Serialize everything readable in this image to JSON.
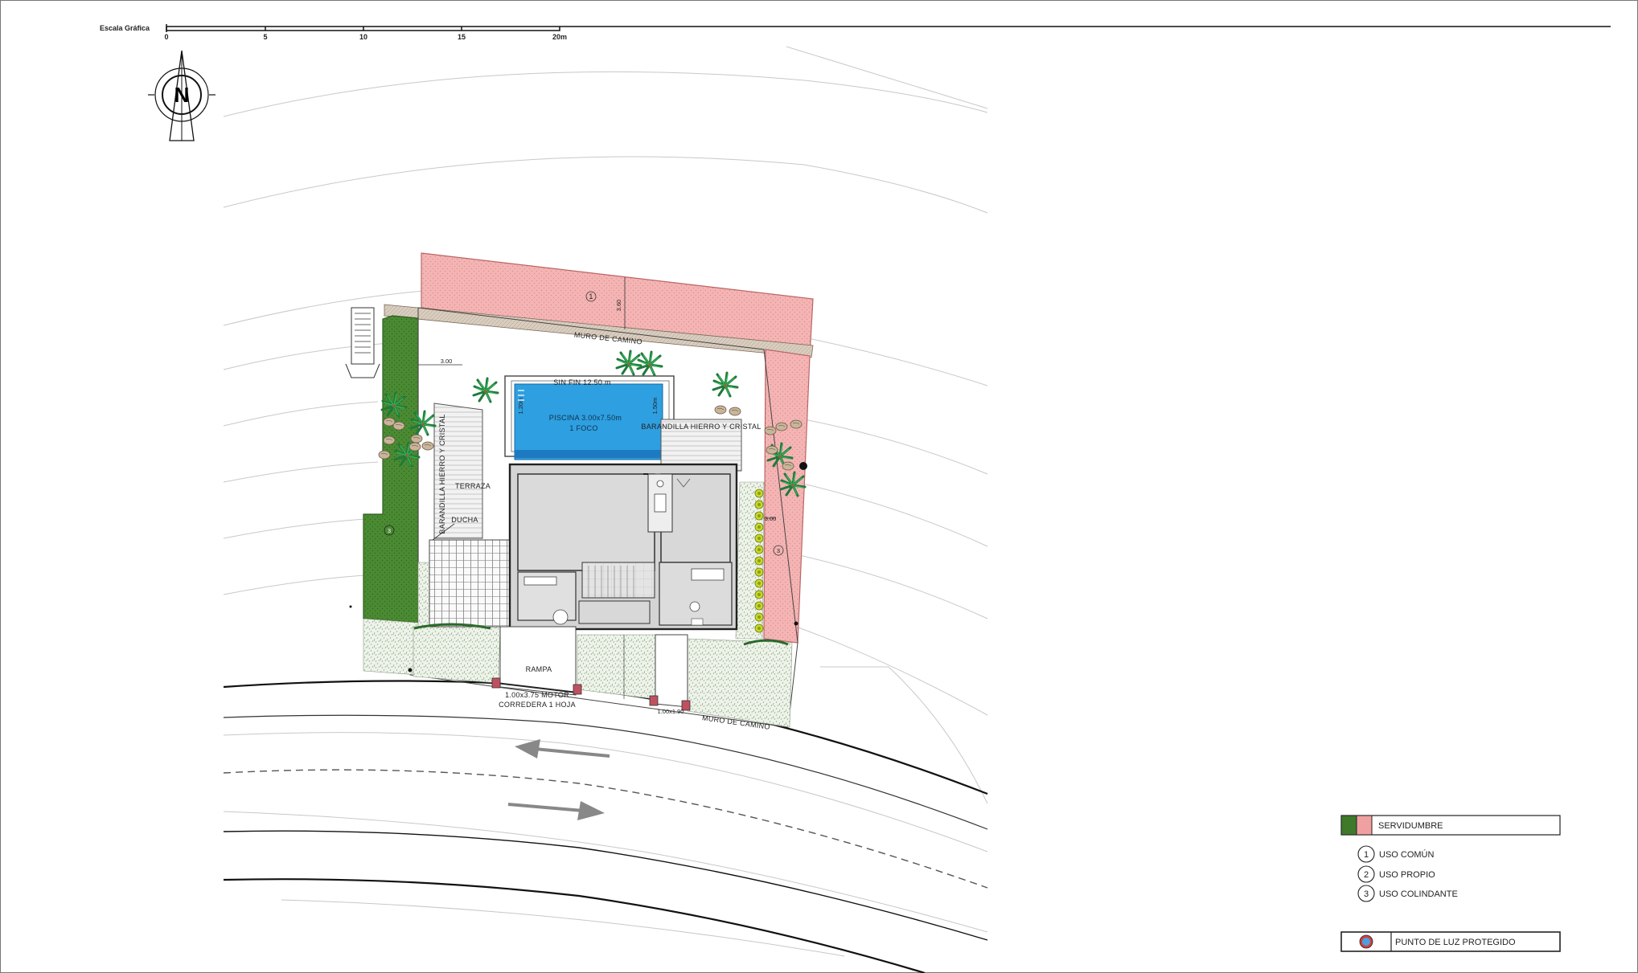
{
  "scale": {
    "title": "Escala Gráfica",
    "ticks": [
      "0",
      "5",
      "10",
      "15",
      "20m"
    ]
  },
  "north": {
    "letter": "N"
  },
  "plan": {
    "road_wall_top": "MURO DE CAMINO",
    "road_wall_bottom": "MURO DE CAMINO",
    "pool": "PISCINA 3.00x7.50m",
    "pool_light": "1 FOCO",
    "pool_top": "SIN FIN 12.50 m",
    "pool_left": "1.20m",
    "pool_right": "1.50m",
    "railing_left": "BARANDILLA HIERRO Y CRISTAL",
    "railing_right": "BARANDILLA HIERRO Y CRISTAL",
    "terrace": "TERRAZA",
    "shower": "DUCHA",
    "ramp": "RAMPA",
    "gate_line1": "1.00x3.75 MOTOR",
    "gate_line2": "CORREDERA 1 HOJA",
    "small_gate": "1.00x1.90",
    "dim_top": "3.60",
    "dim_left": "3.00",
    "dim_right": "3.00",
    "zone_top": "1",
    "zone_left": "3",
    "zone_right": "3"
  },
  "legend": {
    "servidumbre": "SERVIDUMBRE",
    "items": [
      {
        "num": "1",
        "label": "USO COMÚN"
      },
      {
        "num": "2",
        "label": "USO PROPIO"
      },
      {
        "num": "3",
        "label": "USO COLINDANTE"
      }
    ],
    "light": "PUNTO DE LUZ PROTEGIDO"
  },
  "colors": {
    "easement_green": "#3e7a2a",
    "easement_pink": "#f0a0a0",
    "pool_blue": "#2e9fe0",
    "building_gray": "#d4d4d4",
    "light_red": "#d04040",
    "light_blue": "#4aa0e0"
  }
}
